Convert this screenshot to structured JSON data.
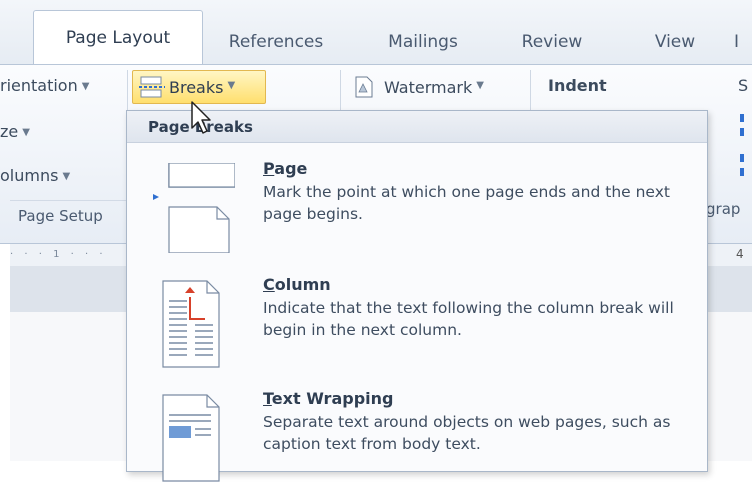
{
  "tabs": [
    {
      "label": "Page Layout",
      "active": true
    },
    {
      "label": "References"
    },
    {
      "label": "Mailings"
    },
    {
      "label": "Review"
    },
    {
      "label": "View"
    },
    {
      "label": "I"
    }
  ],
  "ribbon": {
    "orientation": "rientation",
    "size": "ze",
    "columns": "olumns",
    "page_setup": "Page Setup",
    "breaks": "Breaks",
    "watermark": "Watermark",
    "indent": "Indent",
    "spacing_partial": "S",
    "paragraph_partial": "grap",
    "ruler_number": "4"
  },
  "breaks_menu": {
    "section_header": "Page Breaks",
    "items": [
      {
        "title": "Page",
        "accelerator": "P",
        "title_rest": "age",
        "description": "Mark the point at which one page ends and the next page begins."
      },
      {
        "title": "Column",
        "accelerator": "C",
        "title_rest": "olumn",
        "description": "Indicate that the text following the column break will begin in the next column."
      },
      {
        "title": "Text Wrapping",
        "accelerator": "T",
        "title_rest": "ext Wrapping",
        "description": "Separate text around objects on web pages, such as caption text from body text."
      }
    ]
  },
  "colors": {
    "highlight": "#ffdf6e",
    "accent_red": "#d7412a",
    "accent_blue": "#2f6fd0"
  }
}
